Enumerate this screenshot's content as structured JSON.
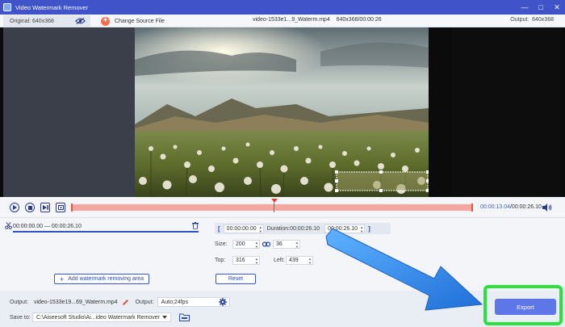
{
  "window": {
    "title": "Video Watermark Remover",
    "controls": [
      "minimize",
      "maximize",
      "close"
    ]
  },
  "infobar": {
    "original_label": "Original: 640x368",
    "change_source_label": "Change Source File",
    "file_info": "video-1533e1...9_Waterm.mp4    640x368/00:00:26",
    "output_label": "Output:  640x368"
  },
  "player": {
    "current_time": "00:00:13.04",
    "total_time": "/00:00:26.10",
    "progress_fraction": 0.5
  },
  "segment": {
    "range": "00:00:00.00 — 00:00:26.10"
  },
  "trim": {
    "start": "00:00:00.00",
    "duration": "Duration:00:00:26.10",
    "end": "00:00:26.10"
  },
  "params": {
    "size_label": "Size:",
    "width": "200",
    "height": "36",
    "top_label": "Top:",
    "top": "316",
    "left_label": "Left:",
    "left": "439"
  },
  "buttons": {
    "add_area": "Add watermark removing area",
    "reset": "Reset",
    "export": "Export"
  },
  "bottom": {
    "output_label": "Output:",
    "output_file": "video-1533e19...69_Waterm.mp4",
    "output_format_label": "Output:",
    "output_format": "Auto;24fps",
    "save_label": "Save to:",
    "save_path": "C:\\Aiseesoft Studio\\Ai...ideo Watermark Remover"
  },
  "colors": {
    "titlebar": "#4153c8",
    "accent": "#3151c4",
    "timeline": "#f5a6a0",
    "export_button": "#5d77e8",
    "highlight": "#29e33c",
    "arrow": "#2e8bf0"
  }
}
